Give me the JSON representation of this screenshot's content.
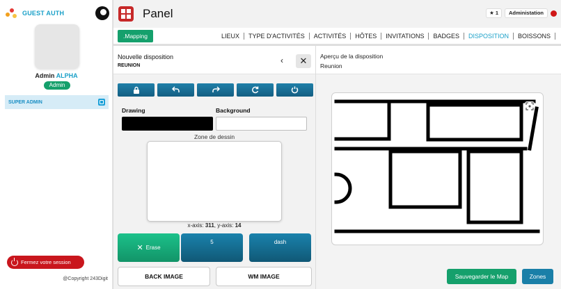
{
  "sidebar": {
    "brand": "GUEST AUTH",
    "user": {
      "first": "Admin",
      "last": "ALPHA",
      "role": "Admin"
    },
    "menu": [
      {
        "label": "SUPER ADMIN"
      }
    ],
    "logout_label": "Fermez votre session",
    "copyright": "@Copyright 243Digit"
  },
  "header": {
    "title": "Panel",
    "count": "1",
    "admin_label": "Administation"
  },
  "nav": {
    "mapping_label": ".Mapping",
    "tabs": [
      "LIEUX",
      "TYPE D'ACTIVITÉS",
      "ACTIVITÉS",
      "HÔTES",
      "INVITATIONS",
      "BADGES",
      "DISPOSITION",
      "BOISSONS"
    ],
    "active_tab": "DISPOSITION"
  },
  "editor": {
    "title": "Nouvelle disposition",
    "subtitle": "REUNION",
    "tools": [
      "lock-icon",
      "undo-icon",
      "redo-icon",
      "refresh-icon",
      "reset-icon"
    ],
    "drawing_label": "Drawing",
    "background_label": "Background",
    "drawing_color": "#000000",
    "background_color": "#ffffff",
    "zone_label": "Zone de dessin",
    "coords": {
      "x_label": "x-axis:",
      "x": "311",
      "y_label": "y-axis:",
      "y": "14"
    },
    "erase_label": "Erase",
    "stroke_value": "5",
    "line_style": "dash",
    "back_image_label": "BACK IMAGE",
    "wm_image_label": "WM IMAGE"
  },
  "preview": {
    "title": "Aperçu de la disposition",
    "subtitle": "Reunion",
    "save_label": "Sauvegarder le Map",
    "zones_label": "Zones"
  },
  "colors": {
    "accent": "#1aa0c8",
    "green": "#15a06c",
    "blue": "#1a7fa8",
    "red": "#c9161d"
  }
}
